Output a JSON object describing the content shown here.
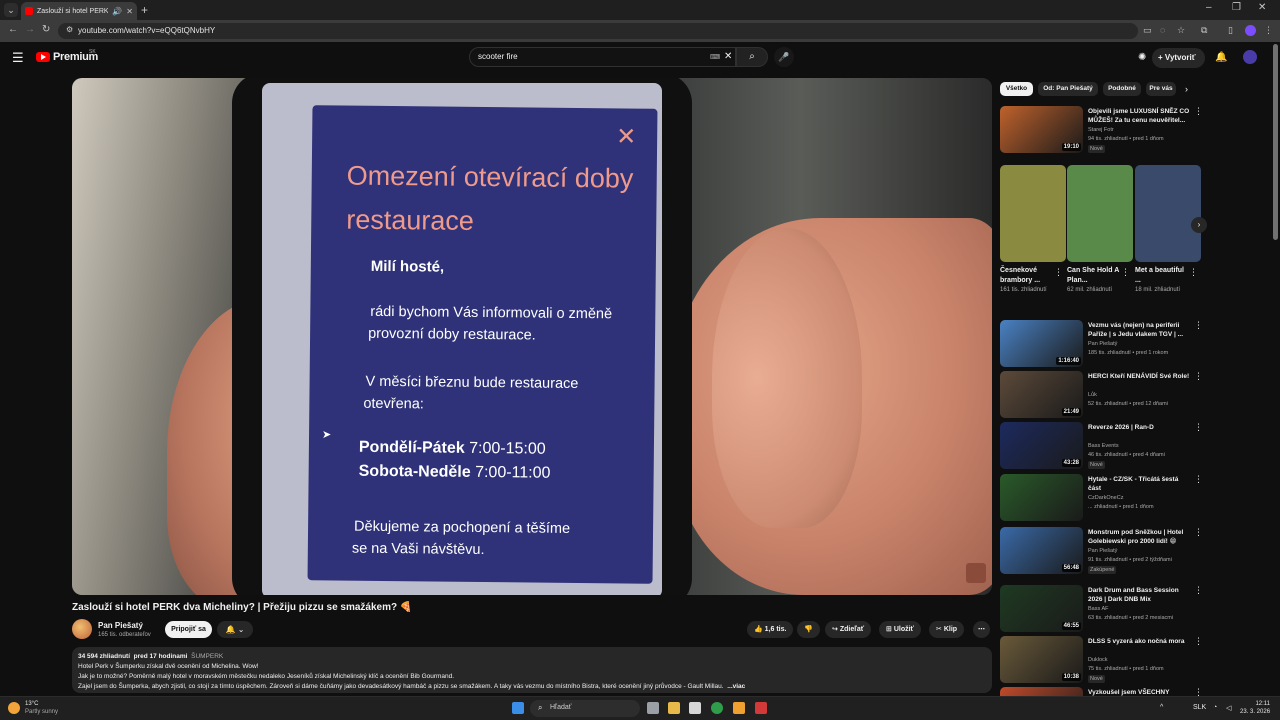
{
  "browser": {
    "tab_title": "Zaslouží si hotel PERK dva Micheliny? | Přežiju pizzu se smažákem? 🍕",
    "url": "youtube.com/watch?v=eQQ6tQNvbHY",
    "new_tab": "+",
    "window_controls": [
      "–",
      "❐",
      "✕"
    ]
  },
  "header": {
    "logo_text": "Premium",
    "region": "SK",
    "search_value": "scooter fire",
    "create_label": "Vytvoriť"
  },
  "video": {
    "sign_title": "Omezení otevírací doby restaurace",
    "sign_greeting": "Milí hosté,",
    "sign_p1_l1": "rádi bychom Vás informovali o změně",
    "sign_p1_l2": "provozní doby restaurace.",
    "sign_p2_l1": "V měsíci březnu bude restaurace",
    "sign_p2_l2": "otevřena:",
    "hours_day1": "Pondělí-Pátek",
    "hours_time1": "7:00-15:00",
    "hours_day2": "Sobota-Neděle",
    "hours_time2": "7:00-11:00",
    "sign_p3_l1": "Děkujeme za pochopení a těšíme",
    "sign_p3_l2": "se na Vaši návštěvu.",
    "title": "Zaslouží si hotel PERK dva Micheliny? | Přežiju pizzu se smažákem? 🍕",
    "channel": "Pan Piešatý",
    "subscribers": "165 tis. odberateľov",
    "join_label": "Pripojiť sa",
    "likes": "1,6 tis.",
    "share_label": "Zdieľať",
    "save_label": "Uložiť",
    "clip_label": "Klip"
  },
  "description": {
    "views": "34 594 zhliadnutí",
    "date": "pred 17 hodinami",
    "tag": "ŠUMPERK",
    "line1": "Hotel Perk v Šumperku získal dvě ocenění od Michelina. Wow!",
    "line2": "Jak je to možné? Poměrně malý hotel v moravském městečku nedaleko Jeseníků získal Michelinský klíč a ocenění Bib Gourmand.",
    "line3": "Zajel jsem do Šumperka, abych zjistil, co stojí za tímto úspěchem. Zároveň si dáme čuňámy jako devadesátkový hambáč a pizzu se smažákem. A taky vás vezmu do místního Bistra, které ocenění jiný průvodce - Gault Millau.",
    "more": "...viac"
  },
  "chips": [
    "Všetko",
    "Od: Pan Piešatý",
    "Podobné",
    "Pre vás"
  ],
  "recommendations": [
    {
      "title": "Objevili jsme LUXUSNÍ SNĚZ CO MŮŽEŠ! Za tu cenu neuvěřitel...",
      "channel": "Starej Fotr",
      "meta": "94 tis. zhliadnutí • pred 1 dňom",
      "badge": "Nové",
      "duration": "19:10",
      "color": "#c0622c"
    },
    {
      "title": "Vezmu vás (nejen) na periferii Paříže | s Jedu vlakem TGV | ...",
      "channel": "Pan Piešatý",
      "meta": "185 tis. zhliadnutí • pred 1 rokom",
      "badge": "",
      "duration": "1:16:40",
      "color": "#4a82c4"
    },
    {
      "title": "HERCI Kteří NENÁVIDÍ Své Role!",
      "channel": "Lůk",
      "meta": "52 tis. zhliadnutí • pred 12 dňami",
      "badge": "",
      "duration": "21:49",
      "color": "#5c4a3a"
    },
    {
      "title": "Reverze 2026 | Ran-D",
      "channel": "Bass Events",
      "meta": "46 tis. zhliadnutí • pred 4 dňami",
      "badge": "Nové",
      "duration": "43:28",
      "color": "#1c2a5e"
    },
    {
      "title": "Hytale - CZ/SK - Třicátá šestá část",
      "channel": "CzDarkOneCz",
      "meta": "... zhliadnutí • pred 1 dňom",
      "badge": "",
      "duration": "",
      "color": "#2a5a2a"
    },
    {
      "title": "Monstrum pod Sněžkou | Hotel Golebiewski pro 2000 lidí! 😁",
      "channel": "Pan Piešatý",
      "meta": "91 tis. zhliadnutí • pred 2 týždňami",
      "badge": "Zakúpené",
      "duration": "56:48",
      "color": "#3a6aa8"
    },
    {
      "title": "Dark Drum and Bass Session 2026 | Dark DNB Mix",
      "channel": "Bass AF",
      "meta": "63 tis. zhliadnutí • pred 2 mesiacmi",
      "badge": "",
      "duration": "46:55",
      "color": "#1f3a22"
    },
    {
      "title": "DLSS 5 vyzerá ako nočná mora",
      "channel": "Duklock",
      "meta": "75 tis. zhliadnutí • pred 1 dňom",
      "badge": "Nové",
      "duration": "10:38",
      "color": "#6a5a3a"
    },
    {
      "title": "Vyzkoušel jsem VŠECHNY",
      "channel": "",
      "meta": "",
      "badge": "",
      "duration": "",
      "color": "#c04a2a"
    }
  ],
  "shorts": [
    {
      "title": "Česnekové brambory ...",
      "views": "161 tis. zhliadnutí",
      "color": "#8a8a40"
    },
    {
      "title": "Can She Hold A Plan...",
      "views": "62 mil. zhliadnutí",
      "color": "#5a8a4a"
    },
    {
      "title": "Met a beautiful ...",
      "views": "18 mil. zhliadnutí",
      "color": "#3a4a6a"
    }
  ],
  "taskbar": {
    "temperature": "13°C",
    "weather": "Partly sunny",
    "search_label": "Hľadať",
    "language": "SLK",
    "time": "12:11",
    "date": "23. 3. 2026"
  }
}
